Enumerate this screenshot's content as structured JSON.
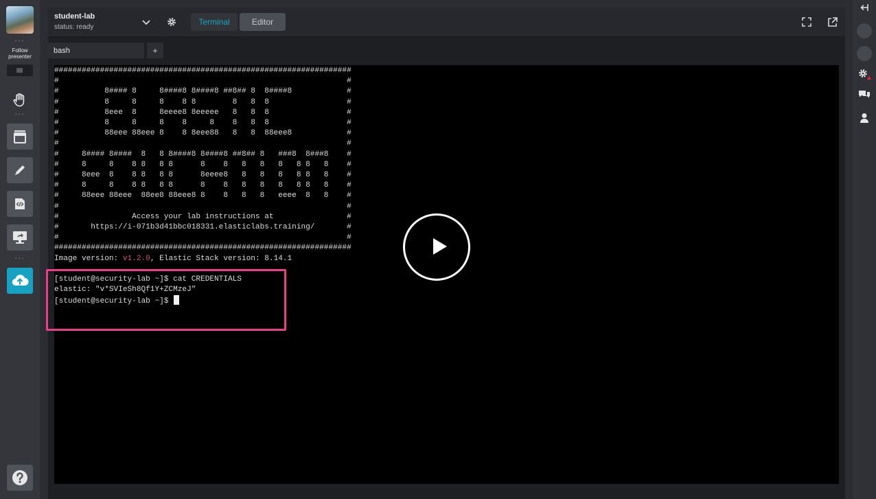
{
  "left_rail": {
    "follow_label_line1": "Follow",
    "follow_label_line2": "presenter",
    "active_accent": "#17a2c4"
  },
  "header": {
    "session_name": "student-lab",
    "session_status": "status: ready",
    "tabs": [
      {
        "label": "Terminal",
        "active": true
      },
      {
        "label": "Editor",
        "active": false
      }
    ],
    "accent": "#19a7c9"
  },
  "shell_tab": {
    "label": "bash",
    "new_tab_label": "+"
  },
  "terminal": {
    "banner_lines": [
      "#################################################################",
      "#                                                               #",
      "#          8#### 8     8####8 8####8 ##8## 8  8####8            #",
      "#          8     8     8    8 8        8   8  8                 #",
      "#          8eee  8     8eeee8 8eeeee   8   8  8                 #",
      "#          8     8     8    8     8    8   8  8                 #",
      "#          88eee 88eee 8    8 8eee88   8   8  88eee8            #",
      "#                                                               #",
      "#     8#### 8####  8   8 8####8 8####8 ##8## 8   ###8  8###8    #",
      "#     8     8    8 8   8 8      8    8   8   8   8   8 8   8    #",
      "#     8eee  8    8 8   8 8      8eeee8   8   8   8   8 8   8    #",
      "#     8     8    8 8   8 8      8    8   8   8   8   8 8   8    #",
      "#     88eee 88eee  88ee8 88eee8 8    8   8   8   eeee  8   8    #",
      "#                                                               #",
      "#                Access your lab instructions at                #",
      "#       https://i-071b3d41bbc018331.elasticlabs.training/       #",
      "#                                                               #",
      "#################################################################"
    ],
    "version_prefix": "Image version: ",
    "image_version": "v1.2.0",
    "stack_version_text": ", Elastic Stack version: 8.14.1",
    "command_line": "[student@security-lab ~]$ cat CREDENTIALS",
    "credentials_line": "elastic: \"v*SVIeSh8Qf1Y+ZCMzeJ\"",
    "prompt_line": "[student@security-lab ~]$ "
  },
  "overlay": {
    "highlight_color": "#ee3b8a"
  },
  "icons": {
    "left": [
      "avatar",
      "hand-icon",
      "window-icon",
      "pencil-icon",
      "code-icon",
      "screen-share-icon",
      "cloud-upload-icon",
      "help-icon"
    ],
    "header": [
      "chevron-down-icon",
      "gear-icon",
      "fullscreen-icon",
      "external-link-icon"
    ],
    "right": [
      "collapse-arrow-icon",
      "participant-avatar-icon",
      "user-avatar-icon",
      "settings-icon",
      "chat-icon",
      "person-icon"
    ]
  }
}
